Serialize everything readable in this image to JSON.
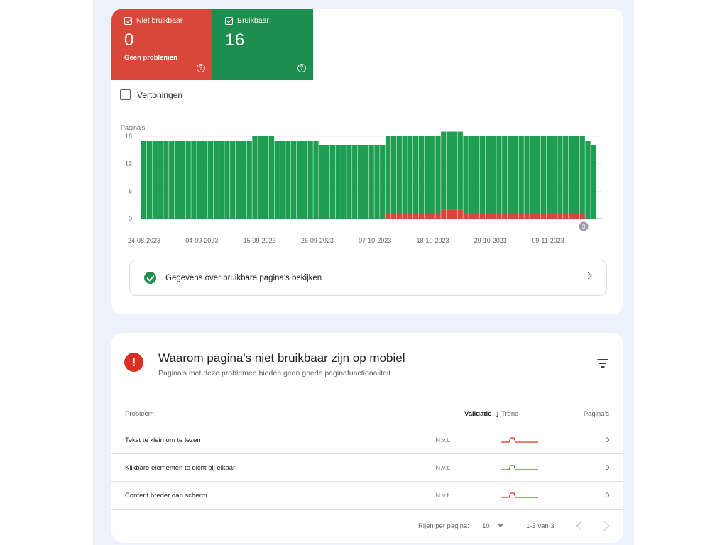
{
  "tiles": {
    "not_usable": {
      "label": "Niet bruikbaar",
      "value": "0",
      "sub": "Geen problemen",
      "color": "#d9473a"
    },
    "usable": {
      "label": "Bruikbaar",
      "value": "16",
      "color": "#1e8e4f"
    },
    "help_glyph": "?"
  },
  "impressions_label": "Vertoningen",
  "chart_data": {
    "type": "bar",
    "ylabel": "Pagina's",
    "yticks": [
      0,
      6,
      12,
      18
    ],
    "ylim": [
      0,
      18
    ],
    "xtick_labels": [
      "24-08-2023",
      "04-09-2023",
      "15-09-2023",
      "26-09-2023",
      "07-10-2023",
      "18-10-2023",
      "29-10-2023",
      "09-11-2023"
    ],
    "annotation": "3",
    "series": [
      {
        "name": "Bruikbaar",
        "color": "#1e9e52",
        "values": [
          17,
          17,
          17,
          17,
          17,
          17,
          17,
          17,
          17,
          17,
          17,
          17,
          17,
          17,
          17,
          17,
          17,
          17,
          17,
          17,
          18,
          18,
          18,
          18,
          17,
          17,
          17,
          17,
          17,
          17,
          17,
          17,
          16,
          16,
          16,
          16,
          16,
          16,
          16,
          16,
          16,
          16,
          16,
          16,
          17,
          17,
          17,
          17,
          17,
          17,
          17,
          17,
          17,
          17,
          17,
          17,
          17,
          17,
          17,
          17,
          17,
          17,
          17,
          17,
          17,
          17,
          17,
          17,
          17,
          17,
          17,
          17,
          17,
          17,
          17,
          17,
          17,
          17,
          17,
          17,
          17,
          16
        ]
      },
      {
        "name": "Niet bruikbaar",
        "color": "#d9473a",
        "values": [
          0,
          0,
          0,
          0,
          0,
          0,
          0,
          0,
          0,
          0,
          0,
          0,
          0,
          0,
          0,
          0,
          0,
          0,
          0,
          0,
          0,
          0,
          0,
          0,
          0,
          0,
          0,
          0,
          0,
          0,
          0,
          0,
          0,
          0,
          0,
          0,
          0,
          0,
          0,
          0,
          0,
          0,
          0,
          0,
          1,
          1,
          1,
          1,
          1,
          1,
          1,
          1,
          1,
          1,
          2,
          2,
          2,
          2,
          1,
          1,
          1,
          1,
          1,
          1,
          1,
          1,
          1,
          1,
          1,
          1,
          1,
          1,
          1,
          1,
          1,
          1,
          1,
          1,
          1,
          1,
          0,
          0
        ]
      }
    ]
  },
  "usable_details_link": "Gegevens over bruikbare pagina's bekijken",
  "issues": {
    "title": "Waarom pagina's niet bruikbaar zijn op mobiel",
    "subtitle": "Pagina's met deze problemen bieden geen goede paginafunctionaliteit",
    "error_glyph": "!",
    "columns": {
      "problem": "Probleem",
      "validation": "Validatie",
      "trend": "Trend",
      "pages": "Pagina's"
    },
    "sort_arrow": "↓",
    "rows": [
      {
        "problem": "Tekst te klein om te lezen",
        "validation": "N.v.t.",
        "pages": "0"
      },
      {
        "problem": "Klikbare elementen te dicht bij elkaar",
        "validation": "N.v.t.",
        "pages": "0"
      },
      {
        "problem": "Content breder dan scherm",
        "validation": "N.v.t.",
        "pages": "0"
      }
    ],
    "trend_color": "#d93025",
    "footer": {
      "rows_per_page_label": "Rijen per pagina:",
      "rows_per_page": "10",
      "range": "1-3 van 3"
    }
  }
}
